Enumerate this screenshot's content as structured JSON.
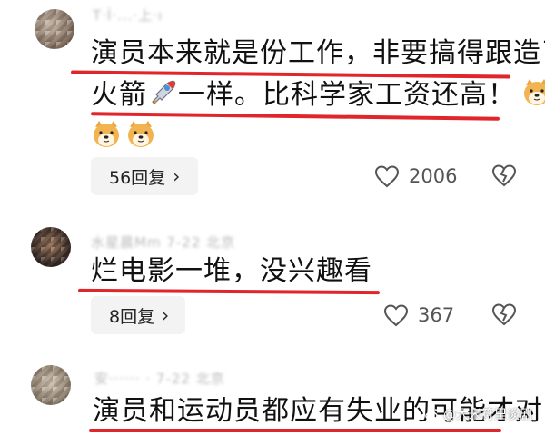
{
  "comments": [
    {
      "meta": "T·İ·...·上·ı",
      "lines": [
        "演员本来就是份工作，非要搞得跟造了",
        "火箭",
        "一样。比科学家工资还高！"
      ],
      "emoji_1": "rocket-emoji",
      "emoji_2": "doge-emoji",
      "reply_label": "56回复",
      "like_count": "2006"
    },
    {
      "meta": "水星晨Mm 7-22 北京",
      "lines": [
        "烂电影一堆，没兴趣看"
      ],
      "reply_label": "8回复",
      "like_count": "367"
    },
    {
      "meta": "安······ · 7-22 北京",
      "lines": [
        "演员和运动员都应有失业的可能才对！"
      ]
    }
  ],
  "watermark": "@大米符里谈剧",
  "colors": {
    "underline": "#e0262b",
    "pill_bg": "#f3f3f3",
    "meta_text": "#b9b9b9"
  }
}
